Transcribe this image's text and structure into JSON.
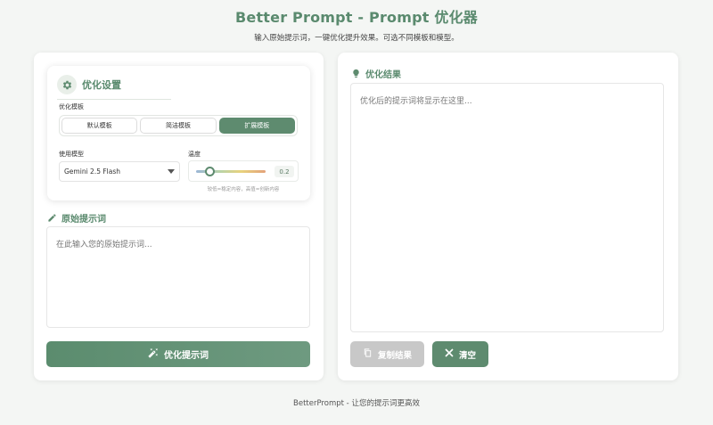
{
  "header": {
    "title": "Better Prompt - Prompt 优化器",
    "subtitle": "输入原始提示词，一键优化提升效果。可选不同模板和模型。"
  },
  "settings": {
    "title": "优化设置",
    "template_label": "优化模板",
    "templates": [
      "默认模板",
      "简洁模板",
      "扩展模板"
    ],
    "active_template": "扩展模板",
    "model_label": "使用模型",
    "model_value": "Gemini 2.5 Flash",
    "temperature_label": "温度",
    "temperature_value": "0.2",
    "temperature_fraction": 0.2,
    "temperature_hint": "较低=稳定内容，高值=创新内容"
  },
  "original": {
    "title": "原始提示词",
    "placeholder": "在此输入您的原始提示词..."
  },
  "optimize_button": "优化提示词",
  "result": {
    "title": "优化结果",
    "placeholder": "优化后的提示词将显示在这里..."
  },
  "actions": {
    "copy_label": "复制结果",
    "clear_label": "清空"
  },
  "footer": "BetterPrompt - 让您的提示词更高效",
  "colors": {
    "accent": "#5e8b6f",
    "disabled": "#c8c8c8"
  },
  "icons": [
    "gear-icon",
    "pencil-icon",
    "magic-wand-icon",
    "lightbulb-icon",
    "copy-icon",
    "close-icon",
    "caret-down-icon"
  ]
}
